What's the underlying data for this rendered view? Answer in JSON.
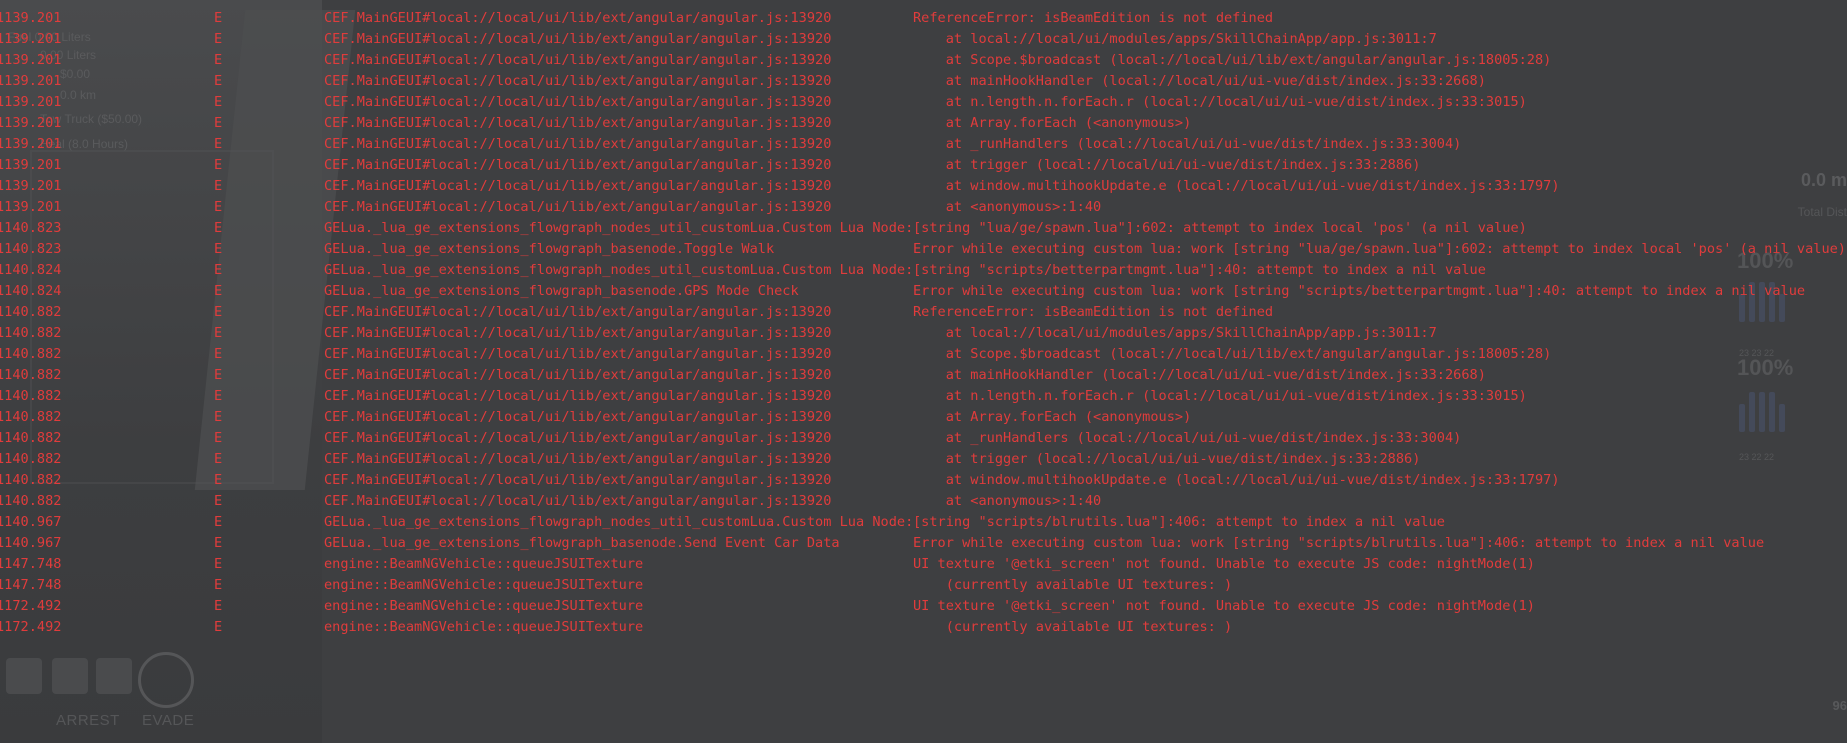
{
  "background": {
    "hud_left": [
      "Fuel 0.00 Liters",
      "0.00 Liters",
      "$0.00",
      "0.0 km",
      "Tow Truck ($50.00)",
      "Heal (8.0 Hours)"
    ],
    "hud_bottom": [
      "ARREST",
      "EVADE"
    ],
    "hud_right": {
      "distance_value": "0.0 m",
      "distance_label": "Total Dist",
      "tire_pct_1": "100%",
      "tire_pct_2": "100%",
      "tire_temps_1": "23 23 22",
      "tire_temps_2": "23 22 22",
      "corner_value": "96"
    }
  },
  "console": {
    "color": "#e03c3c",
    "lines": [
      {
        "time": "1139.201",
        "level": "E",
        "source": "CEF.MainGEUI#local://local/ui/lib/ext/angular/angular.js:13920",
        "message": "ReferenceError: isBeamEdition is not defined"
      },
      {
        "time": "1139.201",
        "level": "E",
        "source": "CEF.MainGEUI#local://local/ui/lib/ext/angular/angular.js:13920",
        "message": "    at local://local/ui/modules/apps/SkillChainApp/app.js:3011:7"
      },
      {
        "time": "1139.201",
        "level": "E",
        "source": "CEF.MainGEUI#local://local/ui/lib/ext/angular/angular.js:13920",
        "message": "    at Scope.$broadcast (local://local/ui/lib/ext/angular/angular.js:18005:28)"
      },
      {
        "time": "1139.201",
        "level": "E",
        "source": "CEF.MainGEUI#local://local/ui/lib/ext/angular/angular.js:13920",
        "message": "    at mainHookHandler (local://local/ui/ui-vue/dist/index.js:33:2668)"
      },
      {
        "time": "1139.201",
        "level": "E",
        "source": "CEF.MainGEUI#local://local/ui/lib/ext/angular/angular.js:13920",
        "message": "    at n.length.n.forEach.r (local://local/ui/ui-vue/dist/index.js:33:3015)"
      },
      {
        "time": "1139.201",
        "level": "E",
        "source": "CEF.MainGEUI#local://local/ui/lib/ext/angular/angular.js:13920",
        "message": "    at Array.forEach (<anonymous>)"
      },
      {
        "time": "1139.201",
        "level": "E",
        "source": "CEF.MainGEUI#local://local/ui/lib/ext/angular/angular.js:13920",
        "message": "    at _runHandlers (local://local/ui/ui-vue/dist/index.js:33:3004)"
      },
      {
        "time": "1139.201",
        "level": "E",
        "source": "CEF.MainGEUI#local://local/ui/lib/ext/angular/angular.js:13920",
        "message": "    at trigger (local://local/ui/ui-vue/dist/index.js:33:2886)"
      },
      {
        "time": "1139.201",
        "level": "E",
        "source": "CEF.MainGEUI#local://local/ui/lib/ext/angular/angular.js:13920",
        "message": "    at window.multihookUpdate.e (local://local/ui/ui-vue/dist/index.js:33:1797)"
      },
      {
        "time": "1139.201",
        "level": "E",
        "source": "CEF.MainGEUI#local://local/ui/lib/ext/angular/angular.js:13920",
        "message": "    at <anonymous>:1:40"
      },
      {
        "time": "1140.823",
        "level": "E",
        "source": "GELua._lua_ge_extensions_flowgraph_nodes_util_customLua.Custom Lua Node:",
        "message": "[string \"lua/ge/spawn.lua\"]:602: attempt to index local 'pos' (a nil value)"
      },
      {
        "time": "1140.823",
        "level": "E",
        "source": "GELua._lua_ge_extensions_flowgraph_basenode.Toggle Walk",
        "message": "Error while executing custom lua: work [string \"lua/ge/spawn.lua\"]:602: attempt to index local 'pos' (a nil value)"
      },
      {
        "time": "1140.824",
        "level": "E",
        "source": "GELua._lua_ge_extensions_flowgraph_nodes_util_customLua.Custom Lua Node:",
        "message": "[string \"scripts/betterpartmgmt.lua\"]:40: attempt to index a nil value"
      },
      {
        "time": "1140.824",
        "level": "E",
        "source": "GELua._lua_ge_extensions_flowgraph_basenode.GPS Mode Check",
        "message": "Error while executing custom lua: work [string \"scripts/betterpartmgmt.lua\"]:40: attempt to index a nil value"
      },
      {
        "time": "1140.882",
        "level": "E",
        "source": "CEF.MainGEUI#local://local/ui/lib/ext/angular/angular.js:13920",
        "message": "ReferenceError: isBeamEdition is not defined"
      },
      {
        "time": "1140.882",
        "level": "E",
        "source": "CEF.MainGEUI#local://local/ui/lib/ext/angular/angular.js:13920",
        "message": "    at local://local/ui/modules/apps/SkillChainApp/app.js:3011:7"
      },
      {
        "time": "1140.882",
        "level": "E",
        "source": "CEF.MainGEUI#local://local/ui/lib/ext/angular/angular.js:13920",
        "message": "    at Scope.$broadcast (local://local/ui/lib/ext/angular/angular.js:18005:28)"
      },
      {
        "time": "1140.882",
        "level": "E",
        "source": "CEF.MainGEUI#local://local/ui/lib/ext/angular/angular.js:13920",
        "message": "    at mainHookHandler (local://local/ui/ui-vue/dist/index.js:33:2668)"
      },
      {
        "time": "1140.882",
        "level": "E",
        "source": "CEF.MainGEUI#local://local/ui/lib/ext/angular/angular.js:13920",
        "message": "    at n.length.n.forEach.r (local://local/ui/ui-vue/dist/index.js:33:3015)"
      },
      {
        "time": "1140.882",
        "level": "E",
        "source": "CEF.MainGEUI#local://local/ui/lib/ext/angular/angular.js:13920",
        "message": "    at Array.forEach (<anonymous>)"
      },
      {
        "time": "1140.882",
        "level": "E",
        "source": "CEF.MainGEUI#local://local/ui/lib/ext/angular/angular.js:13920",
        "message": "    at _runHandlers (local://local/ui/ui-vue/dist/index.js:33:3004)"
      },
      {
        "time": "1140.882",
        "level": "E",
        "source": "CEF.MainGEUI#local://local/ui/lib/ext/angular/angular.js:13920",
        "message": "    at trigger (local://local/ui/ui-vue/dist/index.js:33:2886)"
      },
      {
        "time": "1140.882",
        "level": "E",
        "source": "CEF.MainGEUI#local://local/ui/lib/ext/angular/angular.js:13920",
        "message": "    at window.multihookUpdate.e (local://local/ui/ui-vue/dist/index.js:33:1797)"
      },
      {
        "time": "1140.882",
        "level": "E",
        "source": "CEF.MainGEUI#local://local/ui/lib/ext/angular/angular.js:13920",
        "message": "    at <anonymous>:1:40"
      },
      {
        "time": "1140.967",
        "level": "E",
        "source": "GELua._lua_ge_extensions_flowgraph_nodes_util_customLua.Custom Lua Node:",
        "message": "[string \"scripts/blrutils.lua\"]:406: attempt to index a nil value"
      },
      {
        "time": "1140.967",
        "level": "E",
        "source": "GELua._lua_ge_extensions_flowgraph_basenode.Send Event Car Data",
        "message": "Error while executing custom lua: work [string \"scripts/blrutils.lua\"]:406: attempt to index a nil value"
      },
      {
        "time": "1147.748",
        "level": "E",
        "source": "engine::BeamNGVehicle::queueJSUITexture",
        "message": "UI texture '@etki_screen' not found. Unable to execute JS code: nightMode(1)"
      },
      {
        "time": "1147.748",
        "level": "E",
        "source": "engine::BeamNGVehicle::queueJSUITexture",
        "message": "    (currently available UI textures: )"
      },
      {
        "time": "1172.492",
        "level": "E",
        "source": "engine::BeamNGVehicle::queueJSUITexture",
        "message": "UI texture '@etki_screen' not found. Unable to execute JS code: nightMode(1)"
      },
      {
        "time": "1172.492",
        "level": "E",
        "source": "engine::BeamNGVehicle::queueJSUITexture",
        "message": "    (currently available UI textures: )"
      }
    ]
  }
}
